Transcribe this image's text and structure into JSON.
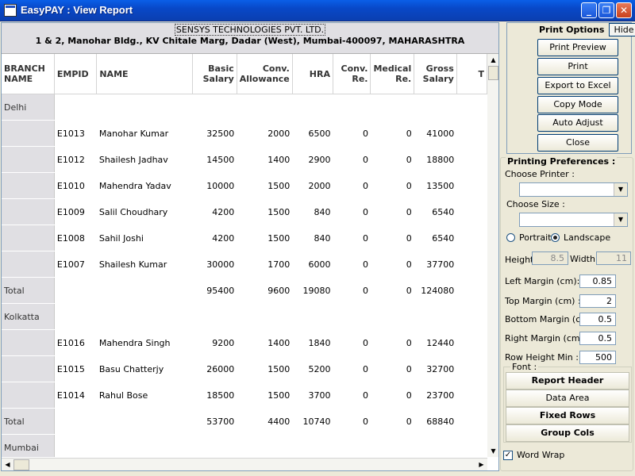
{
  "window": {
    "title": "EasyPAY : View Report",
    "minimize": "_",
    "restore": "❐",
    "close": "✕"
  },
  "report": {
    "company": "SENSYS TECHNOLOGIES PVT. LTD.",
    "address": "1 & 2, Manohar Bldg., KV Chitale Marg, Dadar (West), Mumbai-400097, MAHARASHTRA",
    "columns": [
      "BRANCH NAME",
      "EMPID",
      "NAME",
      "Basic Salary",
      "Conv. Allowance",
      "HRA",
      "Conv. Re.",
      "Medical Re.",
      "Gross Salary",
      "T"
    ],
    "rows": [
      [
        "Delhi",
        "",
        "",
        "",
        "",
        "",
        "",
        "",
        ""
      ],
      [
        "",
        "E1013",
        "Manohar  Kumar",
        "32500",
        "2000",
        "6500",
        "0",
        "0",
        "41000"
      ],
      [
        "",
        "E1012",
        "Shailesh  Jadhav",
        "14500",
        "1400",
        "2900",
        "0",
        "0",
        "18800"
      ],
      [
        "",
        "E1010",
        "Mahendra  Yadav",
        "10000",
        "1500",
        "2000",
        "0",
        "0",
        "13500"
      ],
      [
        "",
        "E1009",
        "Salil  Choudhary",
        "4200",
        "1500",
        "840",
        "0",
        "0",
        "6540"
      ],
      [
        "",
        "E1008",
        "Sahil  Joshi",
        "4200",
        "1500",
        "840",
        "0",
        "0",
        "6540"
      ],
      [
        "",
        "E1007",
        "Shailesh  Kumar",
        "30000",
        "1700",
        "6000",
        "0",
        "0",
        "37700"
      ],
      [
        "Total",
        "",
        "",
        "95400",
        "9600",
        "19080",
        "0",
        "0",
        "124080"
      ],
      [
        "Kolkatta",
        "",
        "",
        "",
        "",
        "",
        "",
        "",
        ""
      ],
      [
        "",
        "E1016",
        "Mahendra  Singh",
        "9200",
        "1400",
        "1840",
        "0",
        "0",
        "12440"
      ],
      [
        "",
        "E1015",
        "Basu  Chatterjy",
        "26000",
        "1500",
        "5200",
        "0",
        "0",
        "32700"
      ],
      [
        "",
        "E1014",
        "Rahul  Bose",
        "18500",
        "1500",
        "3700",
        "0",
        "0",
        "23700"
      ],
      [
        "Total",
        "",
        "",
        "53700",
        "4400",
        "10740",
        "0",
        "0",
        "68840"
      ],
      [
        "Mumbai",
        "",
        "",
        "",
        "",
        "",
        "",
        "",
        ""
      ]
    ]
  },
  "print_options": {
    "title": "Print Options",
    "hide": "Hide",
    "buttons": [
      "Print Preview",
      "Print",
      "Export to Excel",
      "Copy Mode",
      "Auto Adjust",
      "Close"
    ]
  },
  "prefs": {
    "title": "Printing Preferences :",
    "choose_printer": "Choose Printer :",
    "choose_size": "Choose Size :",
    "portrait": "Portrait",
    "landscape": "Landscape",
    "orientation_selected": "Landscape",
    "height_label": "Height",
    "height": "8.5",
    "width_label": "Width",
    "width": "11",
    "left_margin_label": "Left Margin (cm):",
    "left_margin": "0.85",
    "top_margin_label": "Top Margin (cm) :",
    "top_margin": "2",
    "bottom_margin_label": "Bottom Margin (cm)",
    "bottom_margin": "0.5",
    "right_margin_label": "Right Margin (cm) :",
    "right_margin": "0.5",
    "row_height_label": "Row Height Min :",
    "row_height": "500",
    "font_label": "Font :",
    "font_buttons": [
      "Report Header",
      "Data Area",
      "Fixed Rows",
      "Group Cols"
    ],
    "word_wrap": "Word Wrap",
    "word_wrap_checked": true
  }
}
